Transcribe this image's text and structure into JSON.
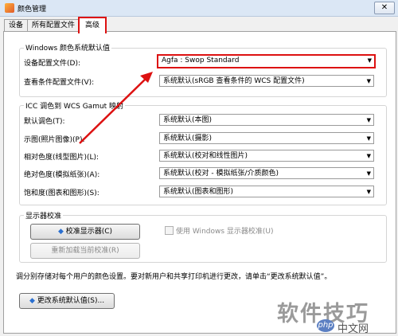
{
  "window": {
    "title": "颜色管理",
    "close_glyph": "✕"
  },
  "tabs": [
    {
      "label": "设备",
      "active": false
    },
    {
      "label": "所有配置文件",
      "active": false
    },
    {
      "label": "高级",
      "active": true
    }
  ],
  "windows_defaults": {
    "heading": "Windows 颜色系统默认值",
    "device_profile": {
      "label": "设备配置文件(D):",
      "value": "Agfa : Swop Standard"
    },
    "viewing_conditions": {
      "label": "查看条件配置文件(V):",
      "value": "系统默认(sRGB 查看条件的 WCS 配置文件)"
    }
  },
  "gamut_mapping": {
    "heading": "ICC 调色到 WCS Gamut 映射",
    "rows": [
      {
        "label": "默认调色(T):",
        "value": "系统默认(本图)"
      },
      {
        "label": "示图(照片图像)(P):",
        "value": "系统默认(摄影)"
      },
      {
        "label": "相对色度(线型图片)(L):",
        "value": "系统默认(校对和线性图片)"
      },
      {
        "label": "绝对色度(模拟纸张)(A):",
        "value": "系统默认(校对 - 模拟纸张/介质颜色)"
      },
      {
        "label": "饱和度(图表和图形)(S):",
        "value": "系统默认(图表和图形)"
      }
    ]
  },
  "calibration": {
    "heading": "显示器校准",
    "calibrate_button": "校准显示器(C)",
    "reload_button": "重新加载当前校准(R)",
    "use_windows_calibration": "使用 Windows 显示器校准(U)"
  },
  "footer": {
    "note": "调分别存储对每个用户的颜色设置。要对新用户和共享打印机进行更改，请单击“更改系统默认值”。",
    "change_defaults_button": "更改系统默认值(S)..."
  },
  "watermarks": {
    "site_cn": "软件技巧",
    "site_php": "php",
    "site_cn2": "中文网"
  },
  "colors": {
    "highlight": "#dd1111",
    "titlebar": "#dbe7f5"
  }
}
